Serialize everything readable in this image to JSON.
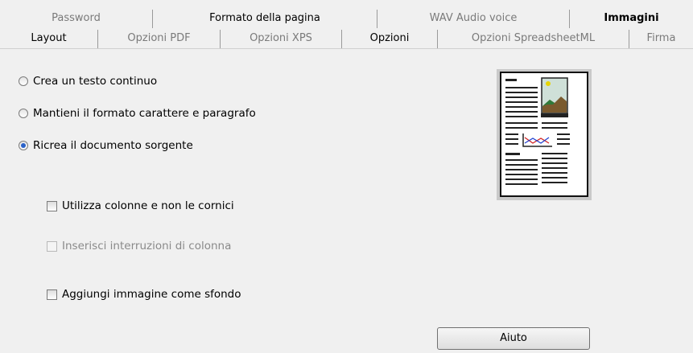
{
  "tabs_row1": [
    {
      "label": "Password",
      "state": "inactive"
    },
    {
      "label": "Formato della pagina",
      "state": "normal"
    },
    {
      "label": "WAV Audio voice",
      "state": "inactive"
    },
    {
      "label": "Immagini",
      "state": "bold"
    }
  ],
  "tabs_row2": [
    {
      "label": "Layout",
      "state": "normal"
    },
    {
      "label": "Opzioni PDF",
      "state": "inactive"
    },
    {
      "label": "Opzioni XPS",
      "state": "inactive"
    },
    {
      "label": "Opzioni",
      "state": "active"
    },
    {
      "label": "Opzioni SpreadsheetML",
      "state": "inactive"
    },
    {
      "label": "Firma",
      "state": "inactive"
    }
  ],
  "options": {
    "radio_continuous_text": {
      "label": "Crea un testo continuo",
      "checked": false
    },
    "radio_keep_format": {
      "label": "Mantieni il formato carattere e paragrafo",
      "checked": false
    },
    "radio_recreate_source": {
      "label": "Ricrea il documento sorgente",
      "checked": true
    },
    "check_use_columns": {
      "label": "Utilizza colonne e non le cornici",
      "checked": false,
      "enabled": true
    },
    "check_column_breaks": {
      "label": "Inserisci interruzioni di colonna",
      "checked": false,
      "enabled": false
    },
    "check_image_background": {
      "label": "Aggiungi immagine come sfondo",
      "checked": false,
      "enabled": true
    }
  },
  "help_button": {
    "label": "Aiuto"
  },
  "colors": {
    "background": "#f0f0f0",
    "radio_dot": "#2a62c9",
    "preview_frame": "#c9c9c9"
  }
}
